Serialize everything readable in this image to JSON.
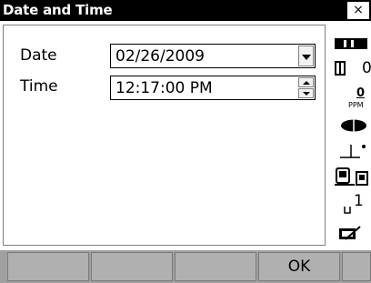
{
  "window": {
    "title": "Date and Time",
    "close_label": "×"
  },
  "form": {
    "date_label": "Date",
    "date_value": "02/26/2009",
    "time_label": "Time",
    "time_value": "12:17:00 PM"
  },
  "status_bar": {
    "items": [
      {
        "icon": "battery-icon"
      },
      {
        "icon": "prism-constant-icon",
        "value": "0"
      },
      {
        "icon": "ppm-icon",
        "value": "0",
        "unit": "PPM"
      },
      {
        "icon": "target-icon"
      },
      {
        "icon": "tilt-icon"
      },
      {
        "icon": "communication-icon"
      },
      {
        "icon": "page-icon",
        "value": "1"
      },
      {
        "icon": "input-mode-icon"
      }
    ]
  },
  "softkeys": [
    "",
    "",
    "",
    "OK",
    ""
  ]
}
